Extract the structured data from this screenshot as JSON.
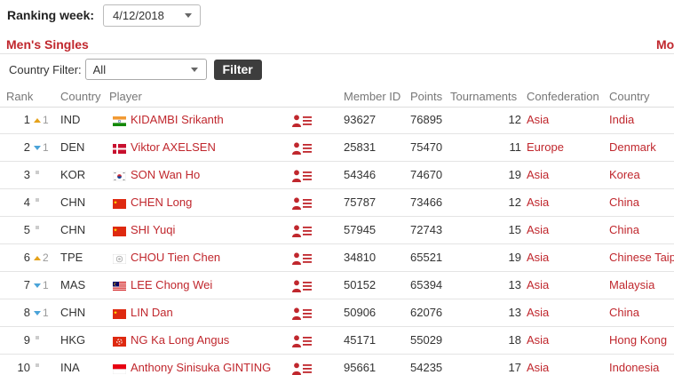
{
  "ranking_week": {
    "label": "Ranking week:",
    "value": "4/12/2018"
  },
  "section": {
    "title": "Men's Singles",
    "more_label": "Mo"
  },
  "filter": {
    "label": "Country Filter:",
    "value": "All",
    "button": "Filter"
  },
  "columns": {
    "rank": "Rank",
    "country": "Country",
    "player": "Player",
    "member_id": "Member ID",
    "points": "Points",
    "tournaments": "Tournaments",
    "confederation": "Confederation",
    "country_name": "Country"
  },
  "colors": {
    "accent": "#c0272d",
    "up": "#e5a21b",
    "down": "#4aa3d8",
    "button": "#3d3d3d"
  },
  "rows": [
    {
      "rank": "1",
      "move": "up",
      "move_by": "1",
      "code": "IND",
      "flag": "india-flag-icon",
      "player": "KIDAMBI Srikanth",
      "member_id": "93627",
      "points": "76895",
      "tournaments": "12",
      "confederation": "Asia",
      "country": "India"
    },
    {
      "rank": "2",
      "move": "down",
      "move_by": "1",
      "code": "DEN",
      "flag": "denmark-flag-icon",
      "player": "Viktor AXELSEN",
      "member_id": "25831",
      "points": "75470",
      "tournaments": "11",
      "confederation": "Europe",
      "country": "Denmark"
    },
    {
      "rank": "3",
      "move": "none",
      "move_by": "",
      "code": "KOR",
      "flag": "korea-flag-icon",
      "player": "SON Wan Ho",
      "member_id": "54346",
      "points": "74670",
      "tournaments": "19",
      "confederation": "Asia",
      "country": "Korea"
    },
    {
      "rank": "4",
      "move": "none",
      "move_by": "",
      "code": "CHN",
      "flag": "china-flag-icon",
      "player": "CHEN Long",
      "member_id": "75787",
      "points": "73466",
      "tournaments": "12",
      "confederation": "Asia",
      "country": "China"
    },
    {
      "rank": "5",
      "move": "none",
      "move_by": "",
      "code": "CHN",
      "flag": "china-flag-icon",
      "player": "SHI Yuqi",
      "member_id": "57945",
      "points": "72743",
      "tournaments": "15",
      "confederation": "Asia",
      "country": "China"
    },
    {
      "rank": "6",
      "move": "up",
      "move_by": "2",
      "code": "TPE",
      "flag": "chinese-taipei-flag-icon",
      "player": "CHOU Tien Chen",
      "member_id": "34810",
      "points": "65521",
      "tournaments": "19",
      "confederation": "Asia",
      "country": "Chinese Taip"
    },
    {
      "rank": "7",
      "move": "down",
      "move_by": "1",
      "code": "MAS",
      "flag": "malaysia-flag-icon",
      "player": "LEE Chong Wei",
      "member_id": "50152",
      "points": "65394",
      "tournaments": "13",
      "confederation": "Asia",
      "country": "Malaysia"
    },
    {
      "rank": "8",
      "move": "down",
      "move_by": "1",
      "code": "CHN",
      "flag": "china-flag-icon",
      "player": "LIN Dan",
      "member_id": "50906",
      "points": "62076",
      "tournaments": "13",
      "confederation": "Asia",
      "country": "China"
    },
    {
      "rank": "9",
      "move": "none",
      "move_by": "",
      "code": "HKG",
      "flag": "hong-kong-flag-icon",
      "player": "NG Ka Long Angus",
      "member_id": "45171",
      "points": "55029",
      "tournaments": "18",
      "confederation": "Asia",
      "country": "Hong Kong"
    },
    {
      "rank": "10",
      "move": "none",
      "move_by": "",
      "code": "INA",
      "flag": "indonesia-flag-icon",
      "player": "Anthony Sinisuka GINTING",
      "member_id": "95661",
      "points": "54235",
      "tournaments": "17",
      "confederation": "Asia",
      "country": "Indonesia"
    }
  ]
}
